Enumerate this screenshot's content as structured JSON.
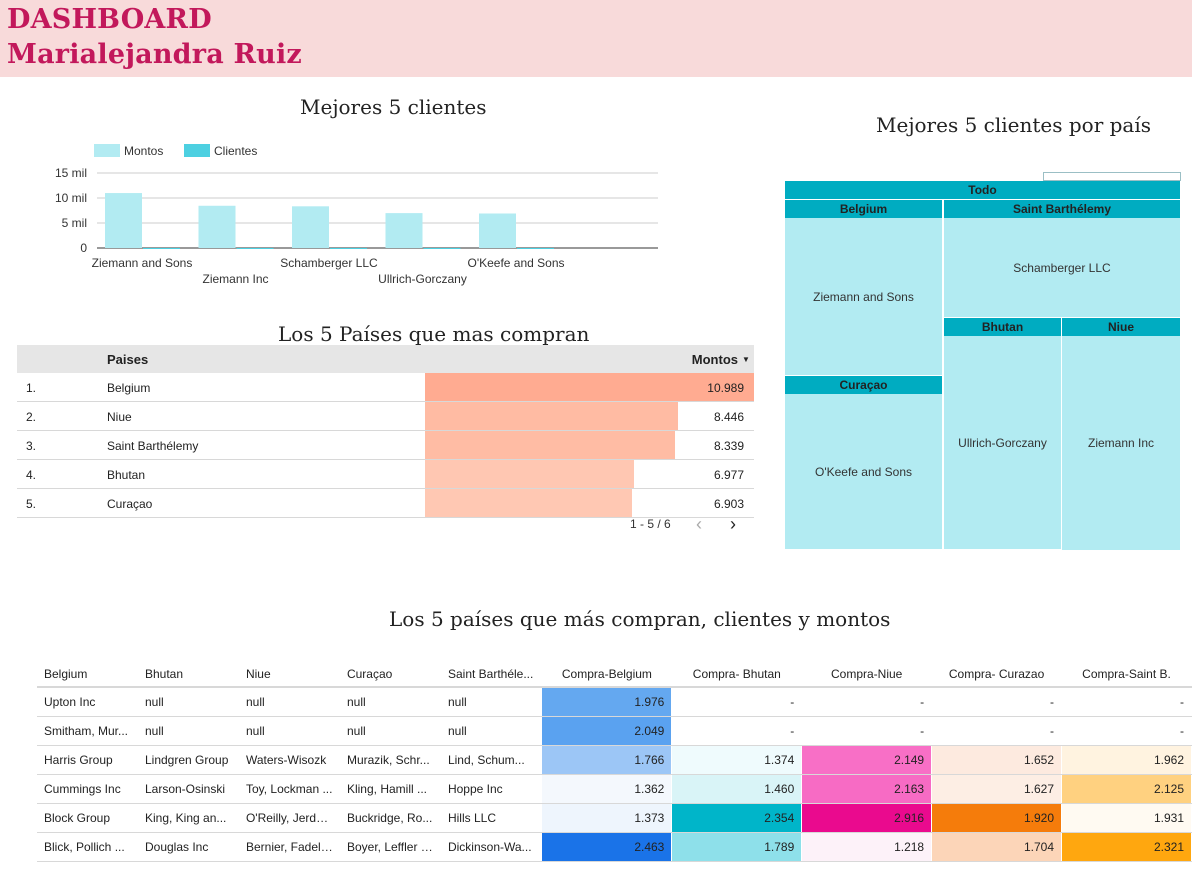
{
  "header": {
    "line1": "DASHBOARD",
    "line2": "Marialejandra Ruiz"
  },
  "titles": {
    "bar_chart": "Mejores 5 clientes",
    "treemap": "Mejores 5 clientes por país",
    "countries_table": "Los 5 Países que mas compran",
    "big_table": "Los 5 países que más compran, clientes y montos"
  },
  "chart_data": {
    "type": "bar",
    "title": "Mejores 5 clientes",
    "categories": [
      "Ziemann and Sons",
      "Ziemann Inc",
      "Schamberger LLC",
      "Ullrich-Gorczany",
      "O'Keefe and Sons"
    ],
    "series": [
      {
        "name": "Montos",
        "color": "#b2ebf2",
        "values": [
          10989,
          8446,
          8339,
          6977,
          6903
        ]
      },
      {
        "name": "Clientes",
        "color": "#4dd0e1",
        "values": [
          1,
          1,
          1,
          1,
          1
        ]
      }
    ],
    "ylim": [
      0,
      15000
    ],
    "yticks": [
      {
        "value": 0,
        "label": "0"
      },
      {
        "value": 5000,
        "label": "5 mil"
      },
      {
        "value": 10000,
        "label": "10 mil"
      },
      {
        "value": 15000,
        "label": "15 mil"
      }
    ],
    "grid": true,
    "legend": "top-left"
  },
  "countries_table": {
    "col_country": "Paises",
    "col_amount": "Montos",
    "sort_icon": "triangle-down-icon",
    "bar_max": 10989,
    "rows": [
      {
        "idx": "1.",
        "country": "Belgium",
        "amount": "10.989",
        "value": 10989,
        "color": "#ffab91"
      },
      {
        "idx": "2.",
        "country": "Niue",
        "amount": "8.446",
        "value": 8446,
        "color": "#ffbba3"
      },
      {
        "idx": "3.",
        "country": "Saint Barthélemy",
        "amount": "8.339",
        "value": 8339,
        "color": "#ffbca4"
      },
      {
        "idx": "4.",
        "country": "Bhutan",
        "amount": "6.977",
        "value": 6977,
        "color": "#ffc7b2"
      },
      {
        "idx": "5.",
        "country": "Curaçao",
        "amount": "6.903",
        "value": 6903,
        "color": "#ffc8b3"
      }
    ],
    "pager": {
      "range": "1 - 5 / 6",
      "prev_icon": "chevron-left-icon",
      "next_icon": "chevron-right-icon"
    }
  },
  "treemap": {
    "root": "Todo",
    "groups": {
      "belgium": {
        "label": "Belgium",
        "client": "Ziemann and Sons"
      },
      "saint_barthelemy": {
        "label": "Saint Barthélemy",
        "client": "Schamberger LLC"
      },
      "curacao": {
        "label": "Curaçao",
        "client": "O'Keefe and Sons"
      },
      "bhutan": {
        "label": "Bhutan",
        "client": "Ullrich-Gorczany"
      },
      "niue": {
        "label": "Niue",
        "client": "Ziemann Inc"
      }
    }
  },
  "big_table": {
    "headers": [
      "Belgium",
      "Bhutan",
      "Niue",
      "Curaçao",
      "Saint Barthéle...",
      "Compra-Belgium",
      "Compra- Bhutan",
      "Compra-Niue",
      "Compra- Curazao",
      "Compra-Saint B."
    ],
    "rows": [
      {
        "cells": [
          "Upton Inc",
          "null",
          "null",
          "null",
          "null",
          "1.976",
          "-",
          "-",
          "-",
          "-"
        ],
        "colors": [
          "#64a8f0",
          "#ffffff",
          "#ffffff",
          "#ffffff",
          "#ffffff"
        ]
      },
      {
        "cells": [
          "Smitham, Mur...",
          "null",
          "null",
          "null",
          "null",
          "2.049",
          "-",
          "-",
          "-",
          "-"
        ],
        "colors": [
          "#5aa2f0",
          "#ffffff",
          "#ffffff",
          "#ffffff",
          "#ffffff"
        ]
      },
      {
        "cells": [
          "Harris Group",
          "Lindgren Group",
          "Waters-Wisozk",
          "Murazik, Schr...",
          "Lind, Schum...",
          "1.766",
          "1.374",
          "2.149",
          "1.652",
          "1.962"
        ],
        "colors": [
          "#9cc6f6",
          "#effbfd",
          "#f86fc6",
          "#fdeadf",
          "#fff3e0"
        ]
      },
      {
        "cells": [
          "Cummings Inc",
          "Larson-Osinski",
          "Toy, Lockman ...",
          "Kling, Hamill ...",
          "Hoppe Inc",
          "1.362",
          "1.460",
          "2.163",
          "1.627",
          "2.125"
        ],
        "colors": [
          "#f4f8fd",
          "#d9f4f7",
          "#f76bc4",
          "#fdeee4",
          "#ffd180"
        ]
      },
      {
        "cells": [
          "Block Group",
          "King, King an...",
          "O'Reilly, Jerde ...",
          "Buckridge, Ro...",
          "Hills LLC",
          "1.373",
          "2.354",
          "2.916",
          "1.920",
          "1.931"
        ],
        "colors": [
          "#eef5fd",
          "#00b5c9",
          "#ea0a8e",
          "#f57c0b",
          "#fffaf2"
        ]
      },
      {
        "cells": [
          "Blick, Pollich ...",
          "Douglas Inc",
          "Bernier, Fadel ...",
          "Boyer, Leffler a...",
          "Dickinson-Wa...",
          "2.463",
          "1.789",
          "1.218",
          "1.704",
          "2.321"
        ],
        "colors": [
          "#1a73e8",
          "#8ee0ea",
          "#fdf2f9",
          "#fcd5b8",
          "#ffa70f"
        ]
      }
    ]
  }
}
